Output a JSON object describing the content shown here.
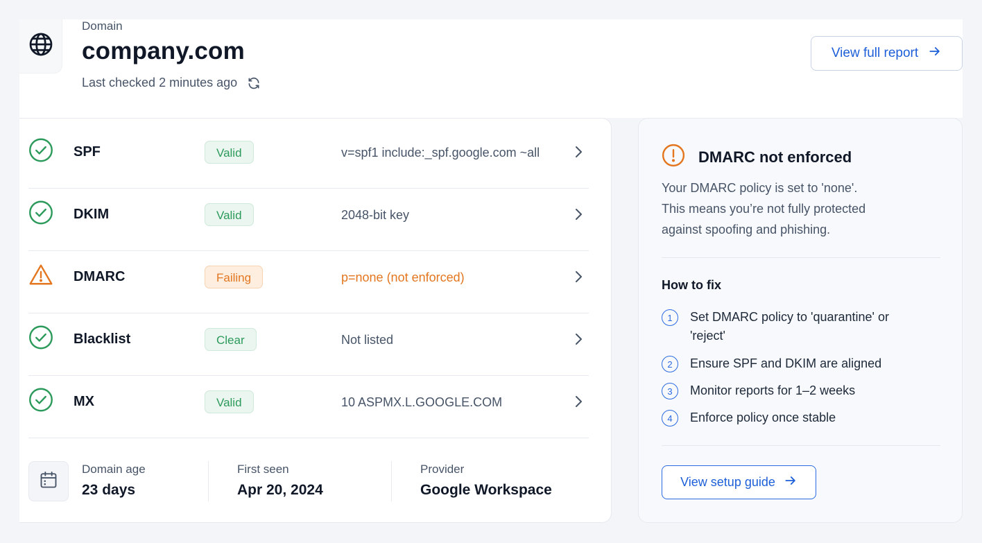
{
  "header": {
    "domain_label": "Domain",
    "domain_name": "company.com",
    "last_checked": "Last checked 2 minutes ago",
    "report_button": "View full report"
  },
  "checks": [
    {
      "name": "SPF",
      "badge": "Valid",
      "status": "ok",
      "detail": "v=spf1 include:_spf.google.com ~all"
    },
    {
      "name": "DKIM",
      "badge": "Valid",
      "status": "ok",
      "detail": "2048-bit key"
    },
    {
      "name": "DMARC",
      "badge": "Failing",
      "status": "warning",
      "detail": "p=none (not enforced)"
    },
    {
      "name": "Blacklist",
      "badge": "Clear",
      "status": "ok",
      "detail": "Not listed"
    },
    {
      "name": "MX",
      "badge": "Valid",
      "status": "ok",
      "detail": "10 ASPMX.L.GOOGLE.COM"
    }
  ],
  "meta": {
    "domain_age_label": "Domain age",
    "domain_age_value": "23 days",
    "first_seen_label": "First seen",
    "first_seen_value": "Apr 20, 2024",
    "provider_label": "Provider",
    "provider_value": "Google Workspace"
  },
  "alert": {
    "title": "DMARC not enforced",
    "description_lines": [
      "Your DMARC policy is set to 'none'.",
      "This means you’re not fully protected",
      "against spoofing and phishing."
    ],
    "fix_heading": "How to fix",
    "steps": [
      {
        "num": "1",
        "text": "Set DMARC policy to 'quarantine' or 'reject'"
      },
      {
        "num": "2",
        "text": "Ensure SPF and DKIM are aligned"
      },
      {
        "num": "3",
        "text": "Monitor reports for 1–2 weeks"
      },
      {
        "num": "4",
        "text": "Enforce policy once stable"
      }
    ],
    "guide_button": "View setup guide"
  },
  "colors": {
    "success": "#2c9a5b",
    "warning": "#e3761f",
    "accent": "#1d5fd8"
  }
}
